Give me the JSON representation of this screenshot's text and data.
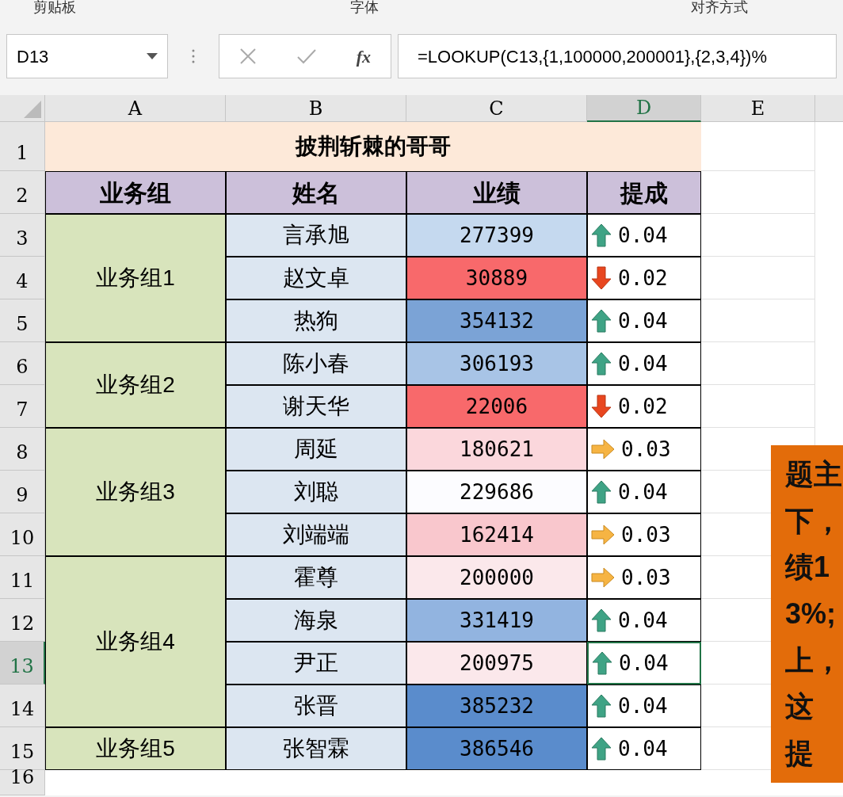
{
  "ribbon": {
    "groups": [
      "剪贴板",
      "字体",
      "对齐方式"
    ]
  },
  "formula_bar": {
    "name_box": "D13",
    "function_label": "fx",
    "formula": "=LOOKUP(C13,{1,100000,200001},{2,3,4})%"
  },
  "columns": [
    {
      "label": "A",
      "selected": false
    },
    {
      "label": "B",
      "selected": false
    },
    {
      "label": "C",
      "selected": false
    },
    {
      "label": "D",
      "selected": true
    },
    {
      "label": "E",
      "selected": false
    }
  ],
  "row_numbers": [
    {
      "label": "1",
      "selected": false
    },
    {
      "label": "2",
      "selected": false
    },
    {
      "label": "3",
      "selected": false
    },
    {
      "label": "4",
      "selected": false
    },
    {
      "label": "5",
      "selected": false
    },
    {
      "label": "6",
      "selected": false
    },
    {
      "label": "7",
      "selected": false
    },
    {
      "label": "8",
      "selected": false
    },
    {
      "label": "9",
      "selected": false
    },
    {
      "label": "10",
      "selected": false
    },
    {
      "label": "11",
      "selected": false
    },
    {
      "label": "12",
      "selected": false
    },
    {
      "label": "13",
      "selected": true
    },
    {
      "label": "14",
      "selected": false
    },
    {
      "label": "15",
      "selected": false
    },
    {
      "label": "16",
      "selected": false
    }
  ],
  "title": "披荆斩棘的哥哥",
  "headers": [
    "业务组",
    "姓名",
    "业绩",
    "提成"
  ],
  "groups": [
    {
      "label": "业务组1",
      "members": [
        {
          "name": "言承旭",
          "sales": "277399",
          "color": "#c5d9ef",
          "kind": "up",
          "commission": "0.04",
          "selected": false
        },
        {
          "name": "赵文卓",
          "sales": "30889",
          "color": "#f8696b",
          "kind": "down",
          "commission": "0.02",
          "selected": false
        },
        {
          "name": "热狗",
          "sales": "354132",
          "color": "#7ba3d6",
          "kind": "up",
          "commission": "0.04",
          "selected": false
        }
      ]
    },
    {
      "label": "业务组2",
      "members": [
        {
          "name": "陈小春",
          "sales": "306193",
          "color": "#a8c4e6",
          "kind": "up",
          "commission": "0.04",
          "selected": false
        },
        {
          "name": "谢天华",
          "sales": "22006",
          "color": "#f8696b",
          "kind": "down",
          "commission": "0.02",
          "selected": false
        }
      ]
    },
    {
      "label": "业务组3",
      "members": [
        {
          "name": "周延",
          "sales": "180621",
          "color": "#fbd7dc",
          "kind": "right",
          "commission": "0.03",
          "selected": false
        },
        {
          "name": "刘聪",
          "sales": "229686",
          "color": "#fcfcff",
          "kind": "up",
          "commission": "0.04",
          "selected": false
        },
        {
          "name": "刘端端",
          "sales": "162414",
          "color": "#f9c7cd",
          "kind": "right",
          "commission": "0.03",
          "selected": false
        }
      ]
    },
    {
      "label": "业务组4",
      "members": [
        {
          "name": "霍尊",
          "sales": "200000",
          "color": "#fbe8eb",
          "kind": "right",
          "commission": "0.03",
          "selected": false
        },
        {
          "name": "海泉",
          "sales": "331419",
          "color": "#92b4e0",
          "kind": "up",
          "commission": "0.04",
          "selected": false
        },
        {
          "name": "尹正",
          "sales": "200975",
          "color": "#fbe8eb",
          "kind": "up",
          "commission": "0.04",
          "selected": true
        },
        {
          "name": "张晋",
          "sales": "385232",
          "color": "#5a8ccc",
          "kind": "up",
          "commission": "0.04",
          "selected": false
        }
      ]
    },
    {
      "label": "业务组5",
      "members": [
        {
          "name": "张智霖",
          "sales": "386546",
          "color": "#5a8ccc",
          "kind": "up",
          "commission": "0.04",
          "selected": false
        }
      ]
    }
  ],
  "note": {
    "lines": [
      "题主",
      "下，",
      "绩1",
      "3%;",
      "上，",
      "这",
      "提"
    ]
  }
}
